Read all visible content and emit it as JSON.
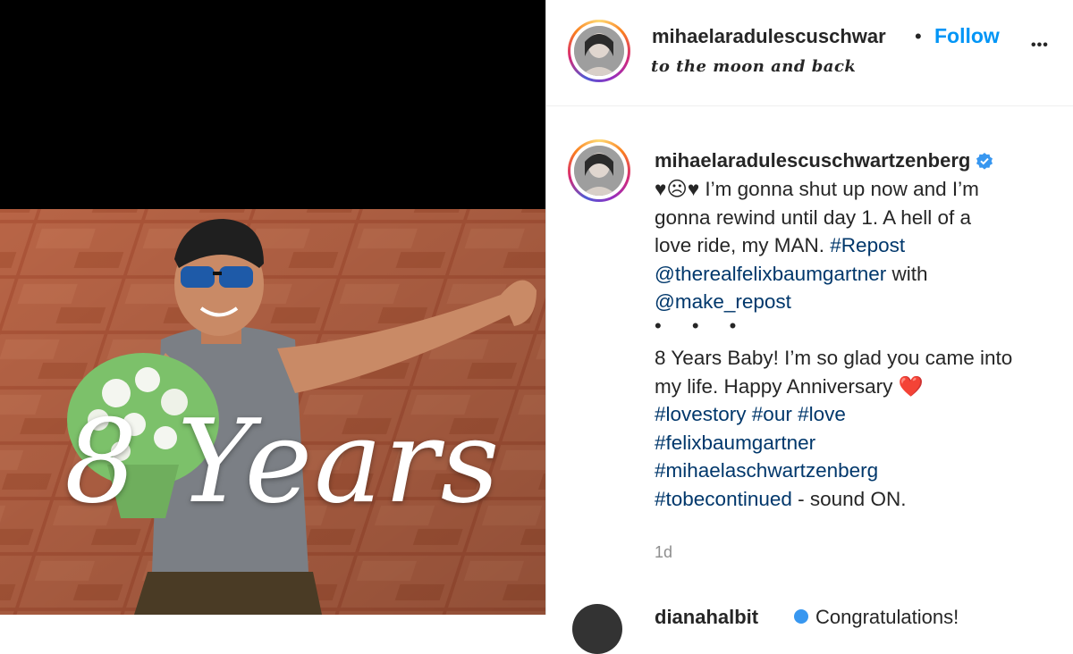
{
  "post": {
    "image_overlay_text": "8 Years"
  },
  "header": {
    "username": "mihaelaradulescuschwar",
    "separator": "•",
    "follow_label": "Follow",
    "more_label": "•••",
    "subtitle": "to the moon and back"
  },
  "caption": {
    "username": "mihaelaradulescuschwartzenberg",
    "lines": [
      {
        "prefix": "♥☹♥ I’m gonna shut up now and I’m"
      },
      {
        "text": "gonna rewind until day 1. A hell of a"
      },
      {
        "text": "love ride, my MAN. ",
        "tag": "#Repost"
      },
      {
        "mention": "@therealfelixbaumgartner",
        "text": " with"
      },
      {
        "mention": "@make_repost"
      },
      {
        "dots": "• • •"
      },
      {
        "text": "8 Years Baby! I’m so glad you came into"
      },
      {
        "text": "my life. Happy Anniversary"
      },
      {
        "tags": "#lovestory #our #love"
      },
      {
        "tags": "#felixbaumgartner"
      },
      {
        "tags": "#mihaelaschwartzenberg"
      },
      {
        "tag": "#tobecontinued",
        "text": " - sound ON."
      }
    ],
    "heart_emoji": "❤️"
  },
  "timestamp": "1d",
  "next_comment": {
    "username_partial": "dianahalbit",
    "text_partial": "Congratulations!"
  },
  "colors": {
    "follow": "#0095f6",
    "link": "#00376b",
    "verified": "#3897f0",
    "heart": "#ed4956",
    "tile": "#b8583a"
  },
  "icons": [
    "verified-badge-icon",
    "more-options-icon",
    "heart-emoji-icon"
  ]
}
